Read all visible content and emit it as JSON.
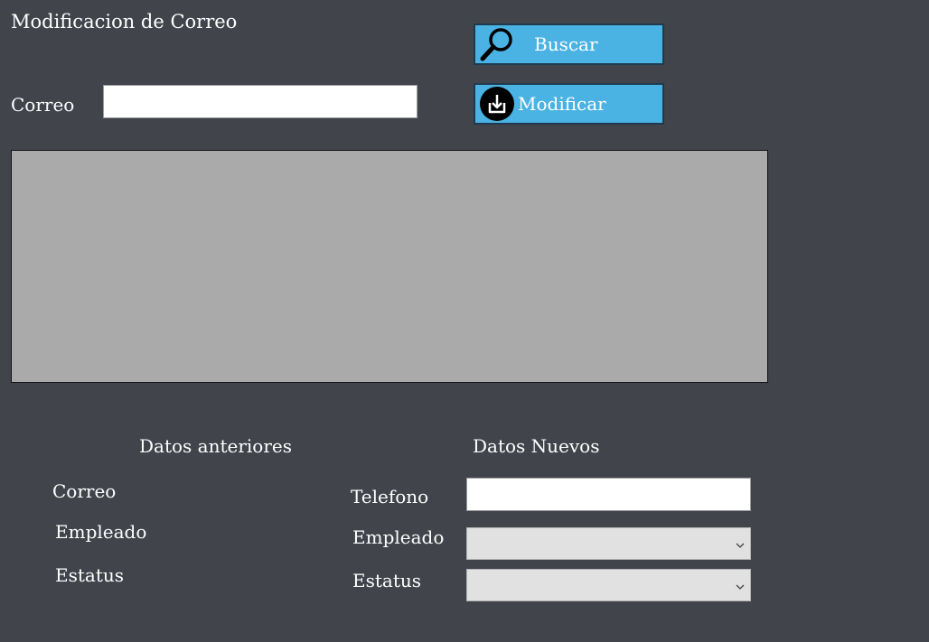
{
  "form": {
    "title": "Modificacion de Correo",
    "correo_label": "Correo",
    "correo_value": "",
    "buttons": {
      "buscar": "Buscar",
      "modificar": "Modificar"
    }
  },
  "sections": {
    "previous_title": "Datos anteriores",
    "new_title": "Datos Nuevos"
  },
  "previous": {
    "correo_label": "Correo",
    "empleado_label": "Empleado",
    "estatus_label": "Estatus"
  },
  "new_data": {
    "telefono_label": "Telefono",
    "telefono_value": "",
    "empleado_label": "Empleado",
    "empleado_value": "",
    "estatus_label": "Estatus",
    "estatus_value": ""
  },
  "icons": {
    "buscar": "search-icon",
    "modificar": "download-icon",
    "dropdown": "chevron-down-icon"
  },
  "colors": {
    "background": "#41444b",
    "button": "#4ab3e3",
    "grid": "#aaaaaa"
  }
}
